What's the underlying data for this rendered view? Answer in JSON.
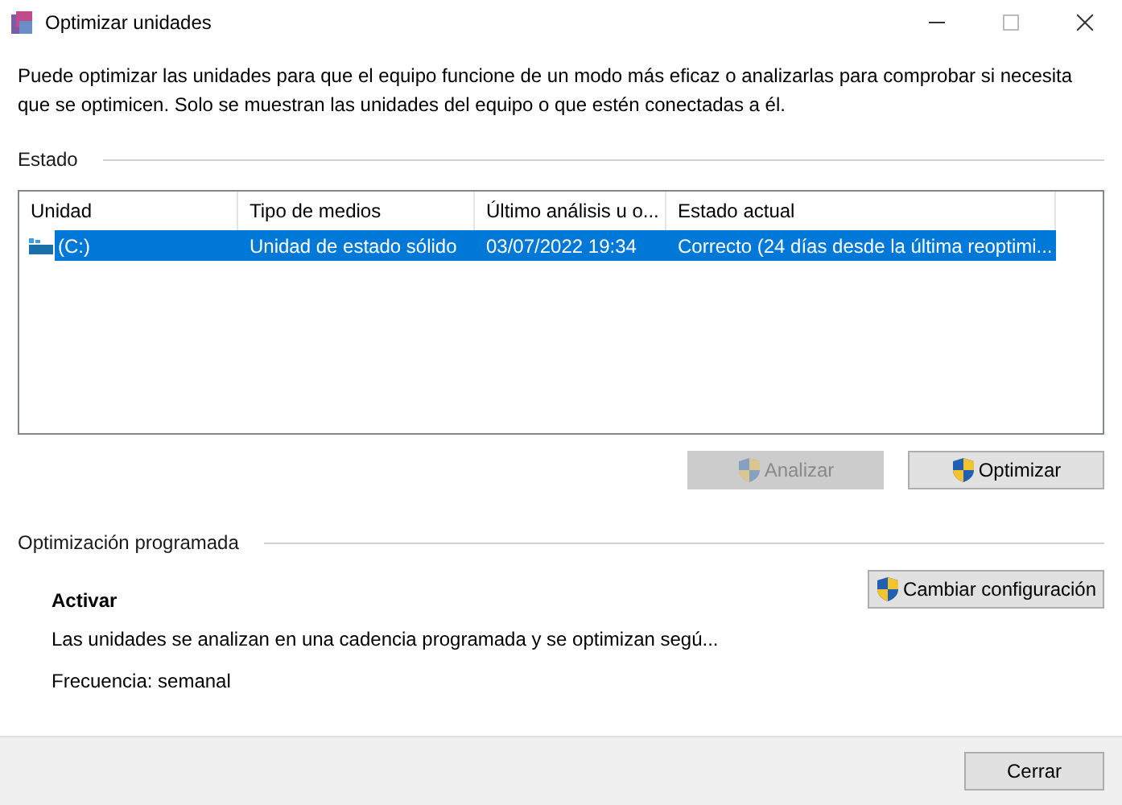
{
  "window": {
    "title": "Optimizar unidades"
  },
  "description": "Puede optimizar las unidades para que el equipo funcione de un modo más eficaz o analizarlas para comprobar si necesita que se optimicen. Solo se muestran las unidades del equipo o que estén conectadas a él.",
  "status_section": {
    "title": "Estado",
    "table": {
      "columns": [
        "Unidad",
        "Tipo de medios",
        "Último análisis u o...",
        "Estado actual"
      ],
      "rows": [
        {
          "cells": [
            "(C:)",
            "Unidad de estado sólido",
            "03/07/2022 19:34",
            "Correcto (24 días desde la última reoptimi..."
          ],
          "selected": true
        }
      ]
    },
    "buttons": [
      {
        "label": "Analizar",
        "disabled": true
      },
      {
        "label": "Optimizar",
        "disabled": false
      }
    ]
  },
  "scheduled_section": {
    "title": "Optimización programada",
    "heading": "Activar",
    "description": "Las unidades se analizan en una cadencia programada y se optimizan segú...",
    "frequency": "Frecuencia: semanal",
    "button": {
      "label": "Cambiar configuración",
      "disabled": false
    }
  },
  "footer": {
    "buttons": [
      {
        "label": "Cerrar",
        "disabled": false
      }
    ]
  }
}
